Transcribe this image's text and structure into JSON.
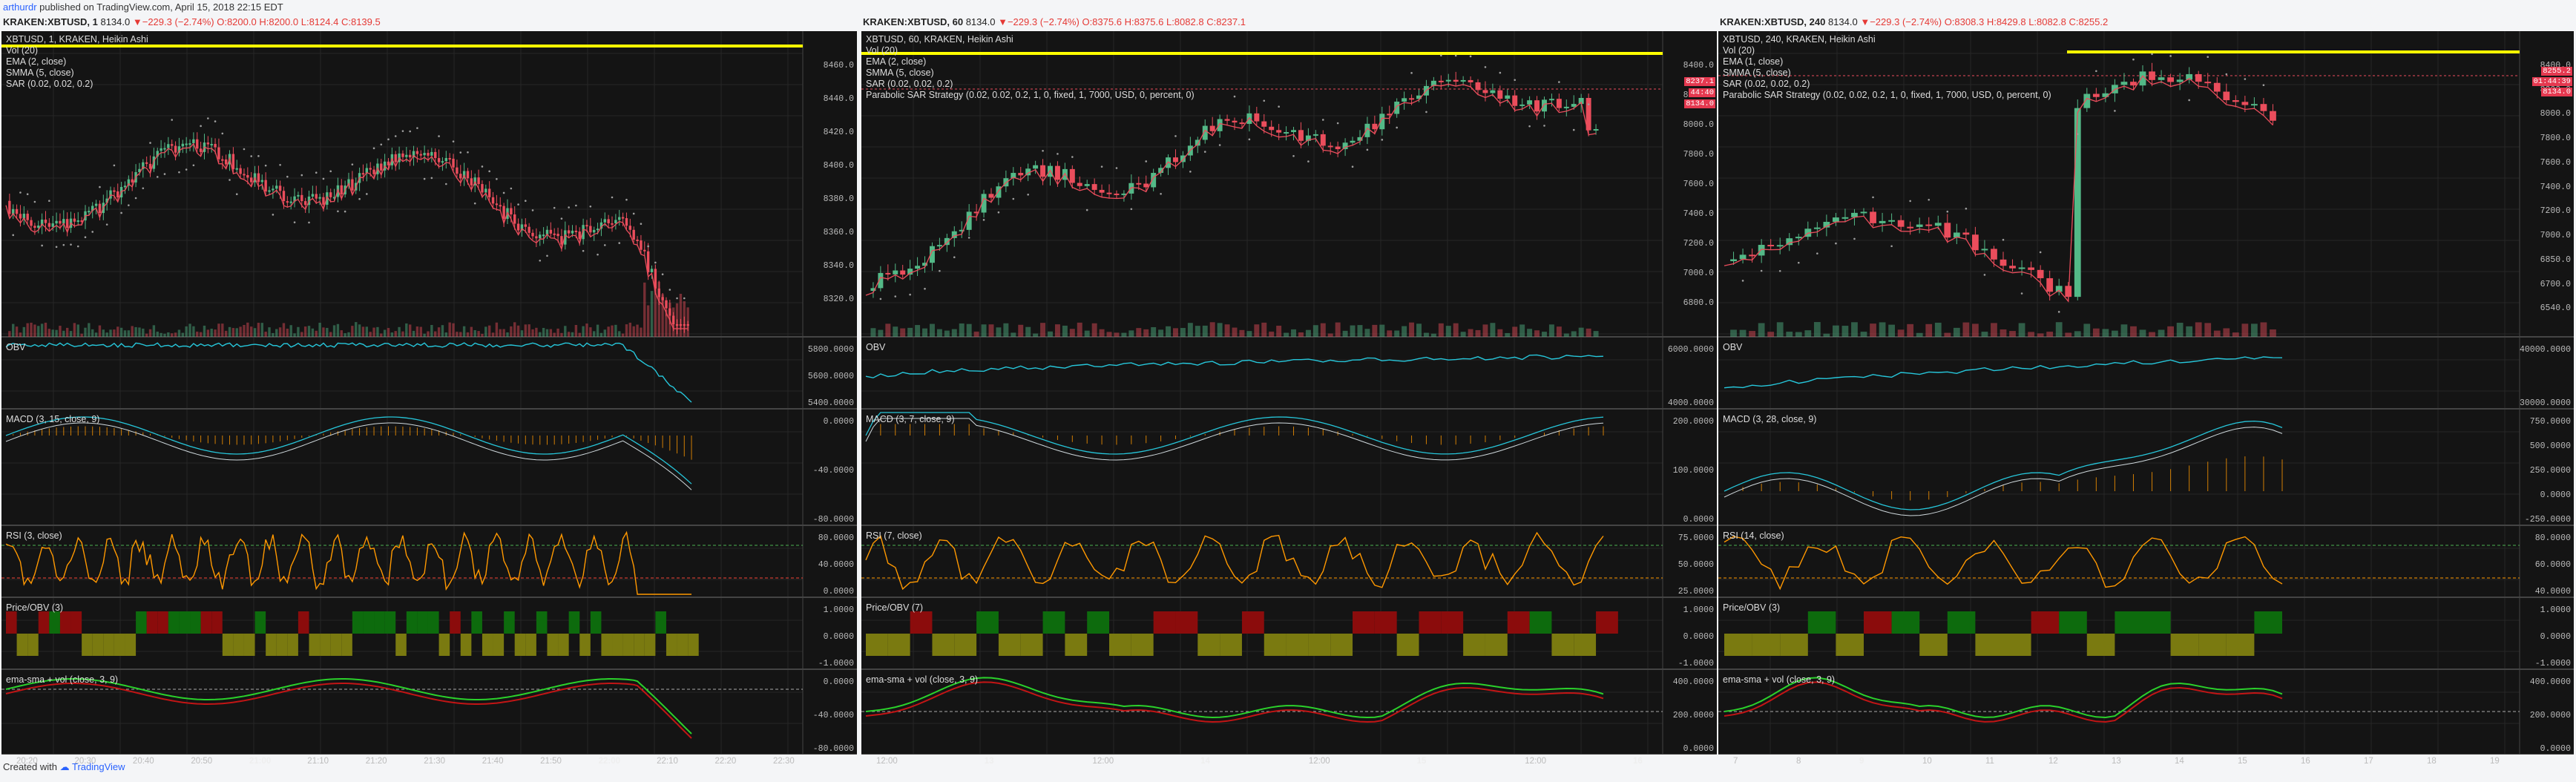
{
  "header": {
    "author": "arthurdr",
    "published": "published on TradingView.com, April 15, 2018 22:15 EDT"
  },
  "panels": [
    {
      "symbol": "KRAKEN:XBTUSD, 1",
      "price": "8134.0",
      "change": "−229.3 (−2.74%)",
      "o": "O:8200.0",
      "h": "H:8200.0",
      "l": "L:8124.4",
      "c": "C:8139.5",
      "studies": [
        "XBTUSD, 1, KRAKEN, Heikin Ashi",
        "Vol (20)",
        "EMA (2, close)",
        "SMMA (5, close)",
        "SAR (0.02, 0.02, 0.2)"
      ],
      "yticks": [
        "8460.0",
        "8440.0",
        "8420.0",
        "8400.0",
        "8380.0",
        "8360.0",
        "8340.0",
        "8320.0"
      ],
      "tags": [],
      "obv_label": "OBV",
      "obv_ticks": [
        "5800.0000",
        "5600.0000",
        "5400.0000"
      ],
      "macd_label": "MACD (3, 15, close, 9)",
      "macd_ticks": [
        "0.0000",
        "-40.0000",
        "-80.0000"
      ],
      "rsi_label": "RSI (3, close)",
      "rsi_ticks": [
        "80.0000",
        "40.0000",
        "0.0000"
      ],
      "pobv_label": "Price/OBV (3)",
      "pobv_ticks": [
        "1.0000",
        "0.0000",
        "-1.0000"
      ],
      "ema_label": "ema-sma + vol (close, 3, 9)",
      "ema_ticks": [
        "0.0000",
        "-40.0000",
        "-80.0000"
      ],
      "xticks": [
        {
          "t": "20:20",
          "b": false
        },
        {
          "t": "20:30",
          "b": false
        },
        {
          "t": "20:40",
          "b": false
        },
        {
          "t": "20:50",
          "b": false
        },
        {
          "t": "21:00",
          "b": true
        },
        {
          "t": "21:10",
          "b": false
        },
        {
          "t": "21:20",
          "b": false
        },
        {
          "t": "21:30",
          "b": false
        },
        {
          "t": "21:40",
          "b": false
        },
        {
          "t": "21:50",
          "b": false
        },
        {
          "t": "22:00",
          "b": true
        },
        {
          "t": "22:10",
          "b": false
        },
        {
          "t": "22:20",
          "b": false
        },
        {
          "t": "22:30",
          "b": false
        }
      ]
    },
    {
      "symbol": "KRAKEN:XBTUSD, 60",
      "price": "8134.0",
      "change": "−229.3 (−2.74%)",
      "o": "O:8375.6",
      "h": "H:8375.6",
      "l": "L:8082.8",
      "c": "C:8237.1",
      "studies": [
        "XBTUSD, 60, KRAKEN, Heikin Ashi",
        "Vol (20)",
        "EMA (2, close)",
        "SMMA (5, close)",
        "SAR (0.02, 0.02, 0.2)",
        "Parabolic SAR Strategy (0.02, 0.02, 0.2, 1, 0, fixed, 1, 7000, USD, 0, percent, 0)"
      ],
      "yticks": [
        "8400.0",
        "8200.0",
        "8000.0",
        "7800.0",
        "7600.0",
        "7400.0",
        "7200.0",
        "7000.0",
        "6800.0"
      ],
      "tags": [
        "8237.1",
        "44:40",
        "8134.0"
      ],
      "obv_label": "OBV",
      "obv_ticks": [
        "6000.0000",
        "4000.0000"
      ],
      "macd_label": "MACD (3, 7, close, 9)",
      "macd_ticks": [
        "200.0000",
        "100.0000",
        "0.0000"
      ],
      "rsi_label": "RSI (7, close)",
      "rsi_ticks": [
        "75.0000",
        "50.0000",
        "25.0000"
      ],
      "pobv_label": "Price/OBV (7)",
      "pobv_ticks": [
        "1.0000",
        "0.0000",
        "-1.0000"
      ],
      "ema_label": "ema-sma + vol (close, 3, 9)",
      "ema_ticks": [
        "400.0000",
        "200.0000",
        "0.0000"
      ],
      "xticks": [
        {
          "t": "12:00",
          "b": false
        },
        {
          "t": "13",
          "b": true
        },
        {
          "t": "12:00",
          "b": false
        },
        {
          "t": "14",
          "b": true
        },
        {
          "t": "12:00",
          "b": false
        },
        {
          "t": "15",
          "b": true
        },
        {
          "t": "12:00",
          "b": false
        },
        {
          "t": "16",
          "b": true
        }
      ]
    },
    {
      "symbol": "KRAKEN:XBTUSD, 240",
      "price": "8134.0",
      "change": "−229.3 (−2.74%)",
      "o": "O:8308.3",
      "h": "H:8429.8",
      "l": "L:8082.8",
      "c": "C:8255.2",
      "studies": [
        "XBTUSD, 240, KRAKEN, Heikin Ashi",
        "Vol (20)",
        "EMA (1, close)",
        "SMMA (5, close)",
        "SAR (0.02, 0.02, 0.2)",
        "Parabolic SAR Strategy (0.02, 0.02, 0.2, 1, 0, fixed, 1, 7000, USD, 0, percent, 0)"
      ],
      "yticks": [
        "8400.0",
        "8200.0",
        "8000.0",
        "7800.0",
        "7600.0",
        "7400.0",
        "7200.0",
        "7000.0",
        "6850.0",
        "6700.0",
        "6540.0"
      ],
      "tags": [
        "8255.2",
        "01:44:39",
        "8134.0"
      ],
      "obv_label": "OBV",
      "obv_ticks": [
        "40000.0000",
        "30000.0000"
      ],
      "macd_label": "MACD (3, 28, close, 9)",
      "macd_ticks": [
        "750.0000",
        "500.0000",
        "250.0000",
        "0.0000",
        "-250.0000"
      ],
      "rsi_label": "RSI (14, close)",
      "rsi_ticks": [
        "80.0000",
        "60.0000",
        "40.0000"
      ],
      "pobv_label": "Price/OBV (3)",
      "pobv_ticks": [
        "1.0000",
        "0.0000",
        "-1.0000"
      ],
      "ema_label": "ema-sma + vol (close, 3, 9)",
      "ema_ticks": [
        "400.0000",
        "200.0000",
        "0.0000"
      ],
      "xticks": [
        {
          "t": "7",
          "b": false
        },
        {
          "t": "8",
          "b": false
        },
        {
          "t": "9",
          "b": true
        },
        {
          "t": "10",
          "b": false
        },
        {
          "t": "11",
          "b": false
        },
        {
          "t": "12",
          "b": false
        },
        {
          "t": "13",
          "b": false
        },
        {
          "t": "14",
          "b": false
        },
        {
          "t": "15",
          "b": false
        },
        {
          "t": "16",
          "b": false
        },
        {
          "t": "17",
          "b": false
        },
        {
          "t": "18",
          "b": false
        },
        {
          "t": "19",
          "b": false
        }
      ]
    }
  ],
  "footer": {
    "created": "Created with",
    "brand": "TradingView"
  },
  "colors": {
    "up": "#53b987",
    "down": "#eb4d5c",
    "orange": "#ff9800",
    "cyan": "#26c6da",
    "yellow": "#ffff00"
  }
}
